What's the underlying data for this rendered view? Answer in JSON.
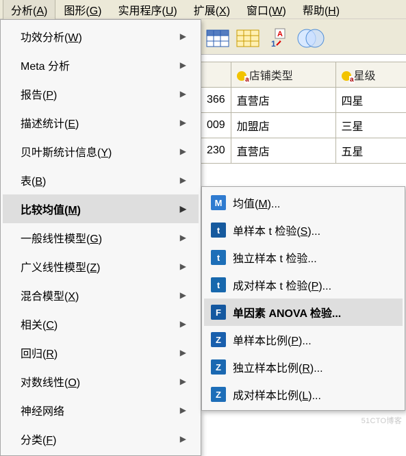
{
  "menubar": {
    "items": [
      {
        "pre": "分析(",
        "k": "A",
        "post": ")"
      },
      {
        "pre": "图形(",
        "k": "G",
        "post": ")"
      },
      {
        "pre": "实用程序(",
        "k": "U",
        "post": ")"
      },
      {
        "pre": "扩展(",
        "k": "X",
        "post": ")"
      },
      {
        "pre": "窗口(",
        "k": "W",
        "post": ")"
      },
      {
        "pre": "帮助(",
        "k": "H",
        "post": ")"
      }
    ]
  },
  "menu1": [
    {
      "pre": "功效分析(",
      "k": "W",
      "post": ")",
      "sub": true
    },
    {
      "pre": "Meta 分析",
      "k": "",
      "post": "",
      "sub": true
    },
    {
      "pre": "报告(",
      "k": "P",
      "post": ")",
      "sub": true
    },
    {
      "pre": "描述统计(",
      "k": "E",
      "post": ")",
      "sub": true
    },
    {
      "pre": "贝叶斯统计信息(",
      "k": "Y",
      "post": ")",
      "sub": true
    },
    {
      "pre": "表(",
      "k": "B",
      "post": ")",
      "sub": true
    },
    {
      "pre": "比较均值(",
      "k": "M",
      "post": ")",
      "sub": true,
      "highlight": true
    },
    {
      "pre": "一般线性模型(",
      "k": "G",
      "post": ")",
      "sub": true
    },
    {
      "pre": "广义线性模型(",
      "k": "Z",
      "post": ")",
      "sub": true
    },
    {
      "pre": "混合模型(",
      "k": "X",
      "post": ")",
      "sub": true
    },
    {
      "pre": "相关(",
      "k": "C",
      "post": ")",
      "sub": true
    },
    {
      "pre": "回归(",
      "k": "R",
      "post": ")",
      "sub": true
    },
    {
      "pre": "对数线性(",
      "k": "O",
      "post": ")",
      "sub": true
    },
    {
      "pre": "神经网络",
      "k": "",
      "post": "",
      "sub": true
    },
    {
      "pre": "分类(",
      "k": "F",
      "post": ")",
      "sub": true
    }
  ],
  "menu2": [
    {
      "ico": "ico-m",
      "icoText": "M",
      "pre": "均值(",
      "k": "M",
      "post": ")..."
    },
    {
      "ico": "ico-t",
      "icoText": "t",
      "pre": "单样本 t 检验(",
      "k": "S",
      "post": ")..."
    },
    {
      "ico": "ico-ta",
      "icoText": "t",
      "pre": "独立样本 t 检验...",
      "k": "",
      "post": ""
    },
    {
      "ico": "ico-tp",
      "icoText": "t",
      "pre": "成对样本 t 检验(",
      "k": "P",
      "post": ")..."
    },
    {
      "ico": "ico-f",
      "icoText": "F",
      "pre": "单因素 ANOVA 检验...",
      "k": "",
      "post": "",
      "highlight": true
    },
    {
      "ico": "ico-z",
      "icoText": "Z",
      "pre": "单样本比例(",
      "k": "P",
      "post": ")..."
    },
    {
      "ico": "ico-za",
      "icoText": "Z",
      "pre": "独立样本比例(",
      "k": "R",
      "post": ")..."
    },
    {
      "ico": "ico-zp",
      "icoText": "Z",
      "pre": "成对样本比例(",
      "k": "L",
      "post": ")..."
    }
  ],
  "table": {
    "headers": [
      "店铺类型",
      "星级"
    ],
    "partial_col": [
      "366",
      "009",
      "230"
    ],
    "rows": [
      [
        "直营店",
        "四星"
      ],
      [
        "加盟店",
        "三星"
      ],
      [
        "直营店",
        "五星"
      ]
    ]
  },
  "watermark": "51CTO博客"
}
